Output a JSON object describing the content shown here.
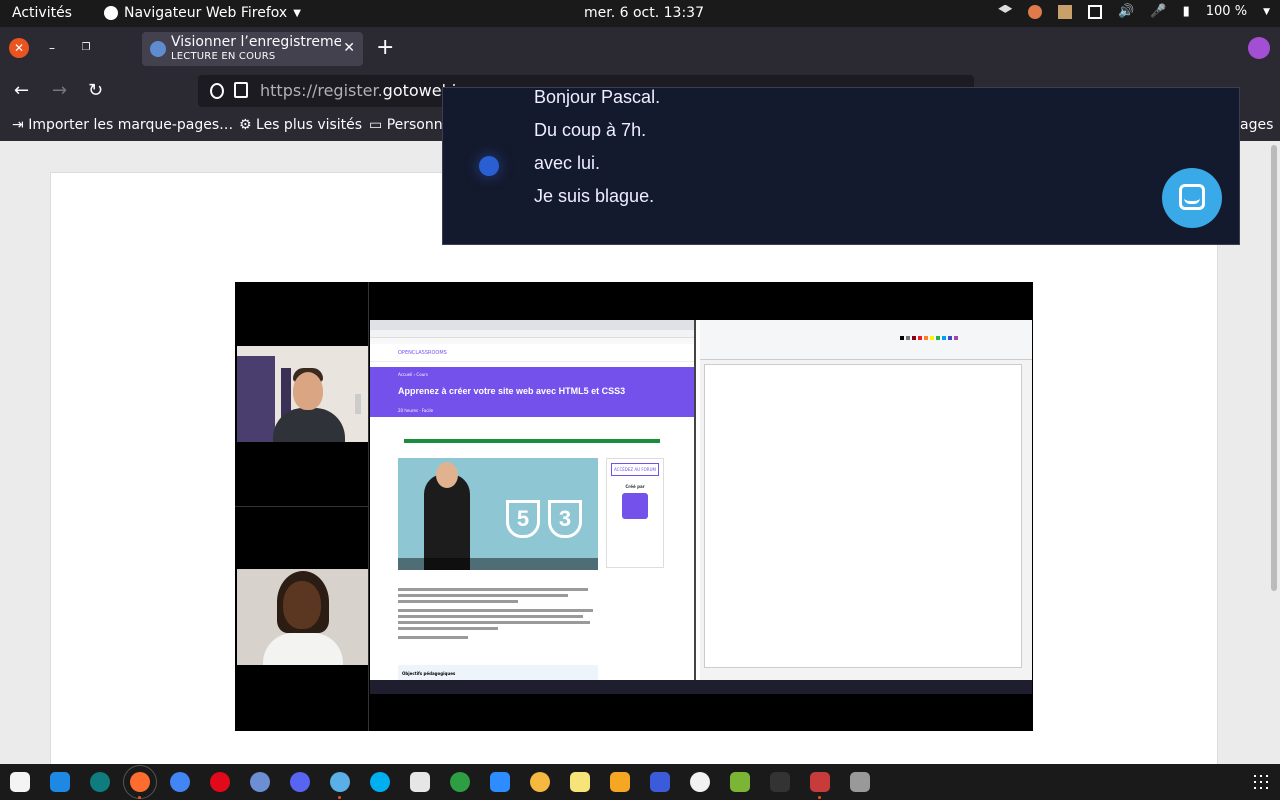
{
  "topbar": {
    "activities": "Activités",
    "app_name": "Navigateur Web Firefox",
    "clock": "mer. 6 oct.  13:37",
    "battery": "100 %"
  },
  "tab": {
    "title": "Visionner l’enregistrement",
    "subtitle": "LECTURE EN COURS"
  },
  "nav": {
    "url_prefix": "https://register.",
    "url_domain": "gotowebin"
  },
  "bookmarks": {
    "import": "Importer les marque-pages…",
    "most_visited": "Les plus visités",
    "personal": "Personn",
    "other": "ages"
  },
  "shared_screen": {
    "course_title": "Apprenez à créer votre site web avec HTML5 et CSS3",
    "join_label": "ACCÉDEZ AU FORUM",
    "created_by": "Créé par",
    "objectives": "Objectifs pédagogiques",
    "badge_html": "5",
    "badge_css": "3"
  },
  "notification": {
    "lines": [
      "Bonjour Pascal.",
      "Du coup à 7h.",
      "avec lui.",
      "Je suis blague."
    ]
  },
  "colors": {
    "accent_purple": "#7451eb",
    "chat_blue": "#39a9e8",
    "close_red": "#e95420"
  }
}
